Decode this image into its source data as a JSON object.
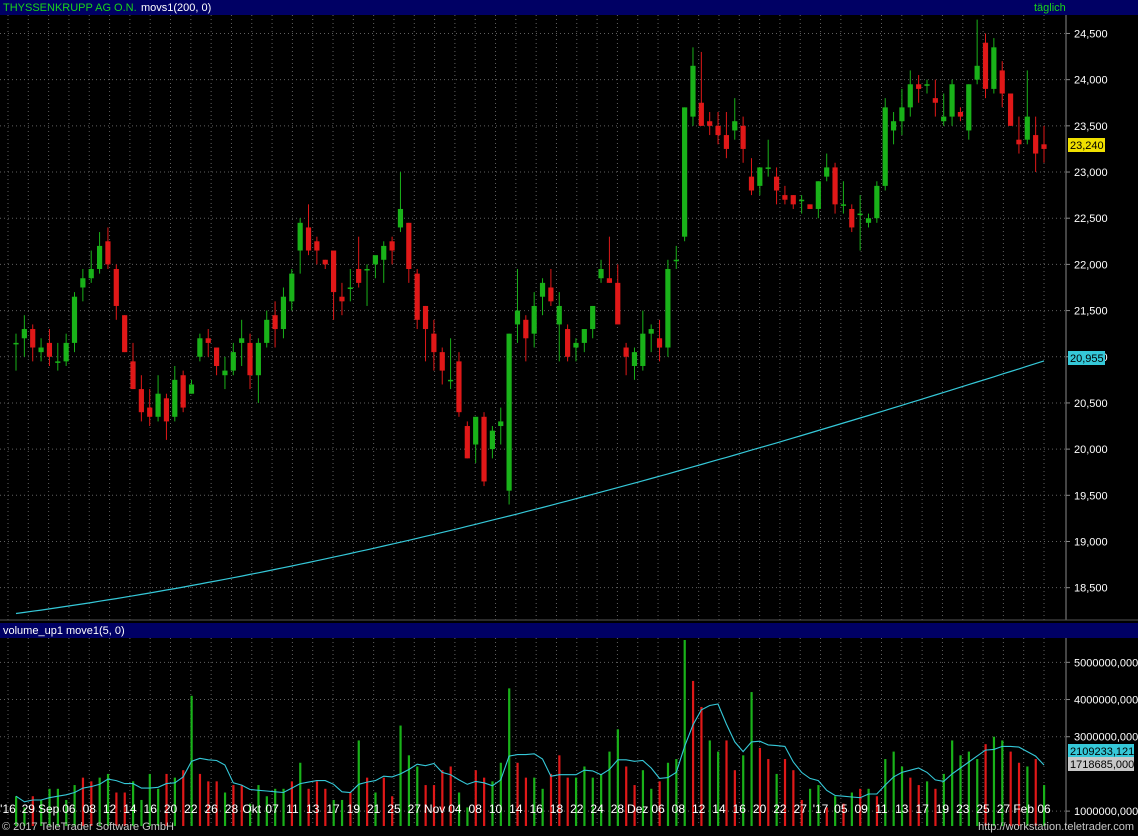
{
  "header": {
    "instrument": "THYSSENKRUPP AG O.N.",
    "indicator": "movs1(200, 0)",
    "interval": "täglich"
  },
  "volume_panel": {
    "title": "volume_up1 move1(5, 0)"
  },
  "price_labels": {
    "last_price": "23,240",
    "ma_value": "20,955"
  },
  "volume_labels": {
    "ma_value": "2109233,121",
    "last_volume": "1718685,000"
  },
  "footer": {
    "copyright": "© 2017 TeleTrader Software GmbH",
    "url": "http://workstation.teletrader.com"
  },
  "colors": {
    "up": "#19b219",
    "down": "#e01818",
    "ma": "#35c8d8",
    "grid": "#606060",
    "title_blue": "#000064"
  },
  "chart_data": [
    {
      "type": "candlestick",
      "title": "THYSSENKRUPP AG O.N.",
      "y_axis": {
        "ticks": [
          "24,500",
          "24,000",
          "23,500",
          "23,000",
          "22,500",
          "22,000",
          "21,500",
          "21,000",
          "20,500",
          "20,000",
          "19,500",
          "19,000",
          "18,500"
        ],
        "ylim": [
          18150,
          24700
        ],
        "position": "right"
      },
      "x_ticks": [
        "'16",
        "29",
        "Sep",
        "06",
        "08",
        "12",
        "14",
        "16",
        "20",
        "22",
        "26",
        "28",
        "Okt",
        "07",
        "11",
        "13",
        "17",
        "19",
        "21",
        "25",
        "27",
        "Nov",
        "04",
        "08",
        "10",
        "14",
        "16",
        "18",
        "22",
        "24",
        "28",
        "Dez",
        "06",
        "08",
        "12",
        "14",
        "16",
        "20",
        "22",
        "27",
        "'17",
        "05",
        "09",
        "11",
        "13",
        "17",
        "19",
        "23",
        "25",
        "27",
        "Feb",
        "06"
      ],
      "grid": true,
      "ohlc": [
        [
          21150,
          21250,
          20850,
          21150
        ],
        [
          21200,
          21450,
          21000,
          21300
        ],
        [
          21300,
          21350,
          20950,
          21100
        ],
        [
          21050,
          21200,
          20950,
          21100
        ],
        [
          21150,
          21300,
          20900,
          21000
        ],
        [
          20950,
          21150,
          20850,
          20950
        ],
        [
          20950,
          21250,
          20900,
          21150
        ],
        [
          21150,
          21700,
          21050,
          21650
        ],
        [
          21750,
          21950,
          21600,
          21850
        ],
        [
          21850,
          22150,
          21800,
          21950
        ],
        [
          21950,
          22350,
          21900,
          22200
        ],
        [
          22250,
          22400,
          21950,
          22000
        ],
        [
          21950,
          22000,
          21400,
          21550
        ],
        [
          21450,
          21450,
          21050,
          21050
        ],
        [
          20950,
          21150,
          20650,
          20650
        ],
        [
          20650,
          20800,
          20300,
          20400
        ],
        [
          20450,
          20650,
          20250,
          20350
        ],
        [
          20350,
          20800,
          20300,
          20600
        ],
        [
          20550,
          20600,
          20100,
          20300
        ],
        [
          20350,
          20900,
          20300,
          20750
        ],
        [
          20800,
          20850,
          20400,
          20450
        ],
        [
          20600,
          20750,
          20600,
          20700
        ],
        [
          21000,
          21250,
          20950,
          21200
        ],
        [
          21200,
          21300,
          21000,
          21150
        ],
        [
          21100,
          21100,
          20800,
          20900
        ],
        [
          20800,
          21000,
          20650,
          20850
        ],
        [
          20850,
          21150,
          20800,
          21050
        ],
        [
          21150,
          21400,
          20900,
          21200
        ],
        [
          21150,
          21250,
          20650,
          20800
        ],
        [
          20800,
          21200,
          20500,
          21150
        ],
        [
          21150,
          21500,
          21100,
          21400
        ],
        [
          21450,
          21600,
          21100,
          21300
        ],
        [
          21300,
          21750,
          21200,
          21650
        ],
        [
          21600,
          21950,
          21500,
          21900
        ],
        [
          22150,
          22500,
          21900,
          22450
        ],
        [
          22400,
          22650,
          22100,
          22150
        ],
        [
          22250,
          22300,
          22000,
          22150
        ],
        [
          22050,
          22050,
          21950,
          22000
        ],
        [
          22150,
          22100,
          21400,
          21700
        ],
        [
          21650,
          21800,
          21450,
          21600
        ],
        [
          21750,
          21950,
          21600,
          21750
        ],
        [
          21950,
          22300,
          21750,
          21800
        ],
        [
          21950,
          22000,
          21550,
          21950
        ],
        [
          22000,
          22050,
          21850,
          22100
        ],
        [
          22050,
          22250,
          21800,
          22200
        ],
        [
          22250,
          22300,
          22000,
          22150
        ],
        [
          22400,
          23000,
          22350,
          22600
        ],
        [
          22450,
          22450,
          21800,
          21950
        ],
        [
          21900,
          21950,
          21300,
          21400
        ],
        [
          21550,
          21550,
          20950,
          21300
        ],
        [
          21250,
          21400,
          20850,
          21050
        ],
        [
          21050,
          21100,
          20700,
          20850
        ],
        [
          20750,
          21200,
          20650,
          20750
        ],
        [
          20950,
          21050,
          20350,
          20400
        ],
        [
          20250,
          20300,
          19900,
          19900
        ],
        [
          20050,
          20350,
          19850,
          20350
        ],
        [
          20350,
          20400,
          19600,
          19650
        ],
        [
          20000,
          20250,
          19900,
          20200
        ],
        [
          20250,
          20450,
          20050,
          20300
        ],
        [
          19550,
          21250,
          19400,
          21250
        ],
        [
          21350,
          21950,
          21150,
          21500
        ],
        [
          21400,
          21450,
          20950,
          21200
        ],
        [
          21250,
          21700,
          21100,
          21550
        ],
        [
          21650,
          21850,
          21450,
          21800
        ],
        [
          21750,
          21950,
          21550,
          21600
        ],
        [
          21350,
          21700,
          20950,
          21550
        ],
        [
          21300,
          21350,
          20950,
          21000
        ],
        [
          21100,
          21200,
          20950,
          21150
        ],
        [
          21150,
          21300,
          21050,
          21300
        ],
        [
          21300,
          21550,
          21200,
          21550
        ],
        [
          21850,
          22050,
          21800,
          21950
        ],
        [
          21850,
          22300,
          21800,
          21800
        ],
        [
          21800,
          22000,
          21400,
          21350
        ],
        [
          21100,
          21150,
          20800,
          21000
        ],
        [
          20900,
          21100,
          20750,
          21050
        ],
        [
          20900,
          21500,
          20850,
          21250
        ],
        [
          21250,
          21350,
          21050,
          21300
        ],
        [
          21200,
          21400,
          20950,
          21100
        ],
        [
          21100,
          22050,
          21000,
          21950
        ],
        [
          22050,
          22200,
          21950,
          22050
        ],
        [
          22300,
          23700,
          22250,
          23700
        ],
        [
          23600,
          24350,
          23500,
          24150
        ],
        [
          23750,
          24300,
          23500,
          23500
        ],
        [
          23550,
          23650,
          23400,
          23500
        ],
        [
          23500,
          23650,
          23300,
          23400
        ],
        [
          23400,
          23650,
          23150,
          23250
        ],
        [
          23450,
          23800,
          23350,
          23550
        ],
        [
          23500,
          23600,
          23100,
          23250
        ],
        [
          22950,
          23150,
          22750,
          22800
        ],
        [
          22850,
          23000,
          22750,
          23050
        ],
        [
          23050,
          23350,
          22950,
          23050
        ],
        [
          22950,
          23050,
          22650,
          22800
        ],
        [
          22750,
          22850,
          22650,
          22700
        ],
        [
          22750,
          22750,
          22600,
          22650
        ],
        [
          22700,
          22750,
          22550,
          22700
        ],
        [
          22650,
          22650,
          22600,
          22600
        ],
        [
          22600,
          22900,
          22500,
          22900
        ],
        [
          22950,
          23200,
          22900,
          23050
        ],
        [
          23050,
          23100,
          22550,
          22650
        ],
        [
          22650,
          22900,
          22550,
          22650
        ],
        [
          22600,
          22650,
          22350,
          22400
        ],
        [
          22550,
          22750,
          22150,
          22550
        ],
        [
          22450,
          22550,
          22400,
          22500
        ],
        [
          22500,
          22900,
          22450,
          22850
        ],
        [
          22850,
          23800,
          22800,
          23700
        ],
        [
          23450,
          23650,
          23300,
          23550
        ],
        [
          23550,
          23900,
          23400,
          23700
        ],
        [
          23700,
          24100,
          23600,
          23950
        ],
        [
          23950,
          24050,
          23750,
          23900
        ],
        [
          23950,
          24000,
          23850,
          23950
        ],
        [
          23800,
          24000,
          23600,
          23750
        ],
        [
          23550,
          23850,
          23500,
          23600
        ],
        [
          23600,
          24000,
          23500,
          23950
        ],
        [
          23650,
          23700,
          23550,
          23600
        ],
        [
          23450,
          23950,
          23350,
          23950
        ],
        [
          24000,
          24650,
          23950,
          24150
        ],
        [
          24400,
          24500,
          23800,
          23900
        ],
        [
          23900,
          24450,
          23850,
          24350
        ],
        [
          24100,
          24200,
          23700,
          23850
        ],
        [
          23850,
          23850,
          23500,
          23500
        ],
        [
          23350,
          23600,
          23200,
          23300
        ],
        [
          23350,
          24100,
          23300,
          23600
        ],
        [
          23400,
          23600,
          23000,
          23200
        ],
        [
          23300,
          23500,
          23100,
          23250
        ]
      ],
      "moving_average": {
        "name": "movs1(200, 0)",
        "start": 18220,
        "end": 20955,
        "last_label": "20,955"
      }
    },
    {
      "type": "bar",
      "title": "volume_up1 move1(5, 0)",
      "y_axis": {
        "ticks": [
          "5000000,000",
          "4000000,000",
          "3000000,000",
          "1000000,000"
        ],
        "ylim": [
          600000,
          5600000
        ],
        "position": "right"
      },
      "volumes_millions": [
        1.4,
        1.1,
        1.4,
        1.3,
        1.6,
        1.6,
        1.3,
        1.7,
        1.9,
        1.8,
        1.9,
        2.0,
        1.5,
        1.5,
        1.8,
        1.3,
        2.0,
        1.6,
        2.0,
        1.9,
        2.1,
        4.1,
        2.0,
        1.8,
        1.8,
        1.5,
        1.7,
        1.7,
        1.2,
        1.7,
        1.4,
        1.6,
        1.6,
        1.8,
        2.3,
        1.6,
        1.8,
        1.6,
        1.3,
        1.3,
        1.5,
        2.9,
        1.9,
        1.5,
        1.9,
        1.4,
        3.3,
        2.5,
        2.2,
        1.7,
        1.7,
        2.1,
        2.2,
        1.5,
        1.1,
        2.1,
        1.9,
        1.8,
        2.3,
        4.3,
        2.3,
        1.9,
        1.9,
        1.6,
        2.0,
        2.5,
        1.9,
        1.9,
        2.2,
        1.9,
        2.0,
        2.6,
        3.2,
        2.2,
        1.7,
        2.1,
        1.6,
        1.8,
        2.3,
        2.4,
        5.6,
        4.5,
        3.8,
        2.9,
        2.6,
        2.9,
        2.1,
        2.5,
        4.2,
        2.7,
        2.4,
        2.0,
        2.4,
        2.1,
        1.3,
        1.6,
        1.7,
        1.1,
        1.4,
        1.2,
        1.5,
        1.6,
        1.6,
        1.4,
        2.4,
        2.6,
        2.2,
        1.9,
        1.7,
        1.8,
        1.6,
        2.0,
        2.9,
        2.5,
        2.6,
        2.4,
        2.8,
        3.0,
        2.9,
        2.6,
        2.3,
        2.2,
        2.4,
        1.7
      ],
      "up_flags": [
        1,
        1,
        0,
        1,
        1,
        1,
        1,
        1,
        0,
        0,
        1,
        1,
        0,
        0,
        1,
        1,
        1,
        1,
        0,
        1,
        0,
        1,
        0,
        0,
        0,
        1,
        0,
        0,
        1,
        1,
        1,
        1,
        1,
        0,
        1,
        0,
        0,
        0,
        1,
        1,
        0,
        1,
        0,
        1,
        0,
        0,
        1,
        1,
        1,
        0,
        0,
        0,
        0,
        1,
        1,
        0,
        0,
        1,
        1,
        1,
        0,
        0,
        1,
        1,
        0,
        0,
        0,
        1,
        1,
        1,
        1,
        1,
        1,
        0,
        0,
        1,
        1,
        0,
        1,
        1,
        1,
        0,
        0,
        1,
        1,
        0,
        0,
        1,
        1,
        0,
        0,
        1,
        0,
        0,
        0,
        1,
        1,
        0,
        1,
        0,
        1,
        0,
        1,
        0,
        1,
        1,
        1,
        0,
        0,
        1,
        0,
        1,
        1,
        1,
        1,
        1,
        0,
        1,
        1,
        0,
        0,
        1,
        0,
        1
      ],
      "moving_average": {
        "name": "move1(5, 0)",
        "last_label": "2109233,121"
      },
      "last_value_label": "1718685,000"
    }
  ]
}
